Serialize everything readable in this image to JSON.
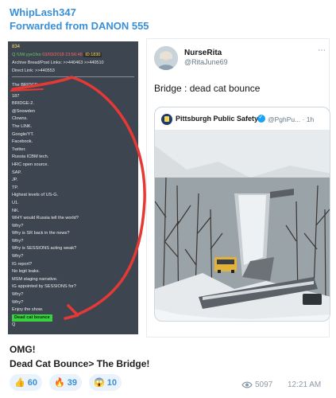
{
  "channel": {
    "name": "WhipLash347",
    "forwarded": "Forwarded from DANON 555"
  },
  "qpost": {
    "number": "834",
    "line1": {
      "prefix": "Q !UW.yye1fxo ",
      "date": "03/03/2018 23:56:48",
      "id_label": "ID:1830"
    },
    "line2": "Archive Bread/Post Links: >>440463 >>440510",
    "line3": "Direct Link: >>440553",
    "lines": [
      "The BRIDGE.",
      "187",
      "BRIDGE-2.",
      "@Snowden",
      "Clowns.",
      "The LINK.",
      "Google/YT.",
      "Facebook.",
      "Twitter.",
      "Russia ICBM tech.",
      "HRC open source.",
      "SAP.",
      "JP.",
      "TP.",
      "Highest levels of US-G.",
      "U1.",
      "NK.",
      "WHY would Russia tell the world?",
      "Why?",
      "Why is SR back in the news?",
      "Why?",
      "Why is SESSIONS acting weak?",
      "Why?",
      "IG report?",
      "No legit leaks.",
      "MSM staging narrative.",
      "IG appointed by SESSIONS for?",
      "Why?",
      "Why?",
      "Enjoy the show."
    ],
    "highlight": "Dead cat bounce",
    "signature": "Q"
  },
  "tweet": {
    "name": "NurseRita",
    "handle": "@RitaJune69",
    "more": "⋯",
    "text": "Bridge : dead cat bounce",
    "quoted": {
      "name": "Pittsburgh Public Safety",
      "handle": "@PghPu...",
      "age": "· 1h"
    }
  },
  "caption": {
    "line1": "OMG!",
    "line2": "Dead Cat Bounce> The Bridge!"
  },
  "reactions": [
    {
      "emoji": "👍",
      "count": "60"
    },
    {
      "emoji": "🔥",
      "count": "39"
    },
    {
      "emoji": "😱",
      "count": "10"
    }
  ],
  "footer": {
    "views": "5097",
    "time": "12:21 AM"
  },
  "colors": {
    "accent": "#3a8fd6",
    "highlight_green": "#39d13f",
    "arrow_red": "#e53935"
  }
}
